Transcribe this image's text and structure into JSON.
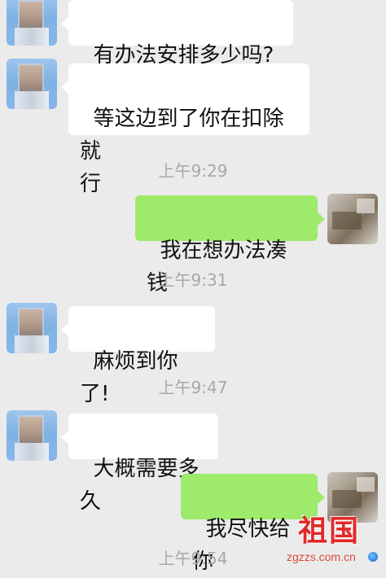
{
  "messages": [
    {
      "side": "left",
      "text": "有办法安排多少吗?"
    },
    {
      "side": "left",
      "text": "等这边到了你在扣除就\n行"
    },
    {
      "side": "right",
      "text": "我在想办法凑钱"
    },
    {
      "side": "left",
      "text": "麻烦到你了!"
    },
    {
      "side": "left",
      "text": "大概需要多久"
    },
    {
      "side": "right",
      "text": "我尽快给你"
    }
  ],
  "timestamps": [
    "上午9:29",
    "上午9:31",
    "上午9:47",
    "上午9:54"
  ],
  "watermark": {
    "title": "祖国",
    "site": "zgzzs.com.cn"
  },
  "colors": {
    "background": "#ebebeb",
    "incoming_bubble": "#ffffff",
    "outgoing_bubble": "#9eea6a",
    "timestamp_text": "#a8a8a8",
    "watermark_red": "#e02a2a"
  }
}
